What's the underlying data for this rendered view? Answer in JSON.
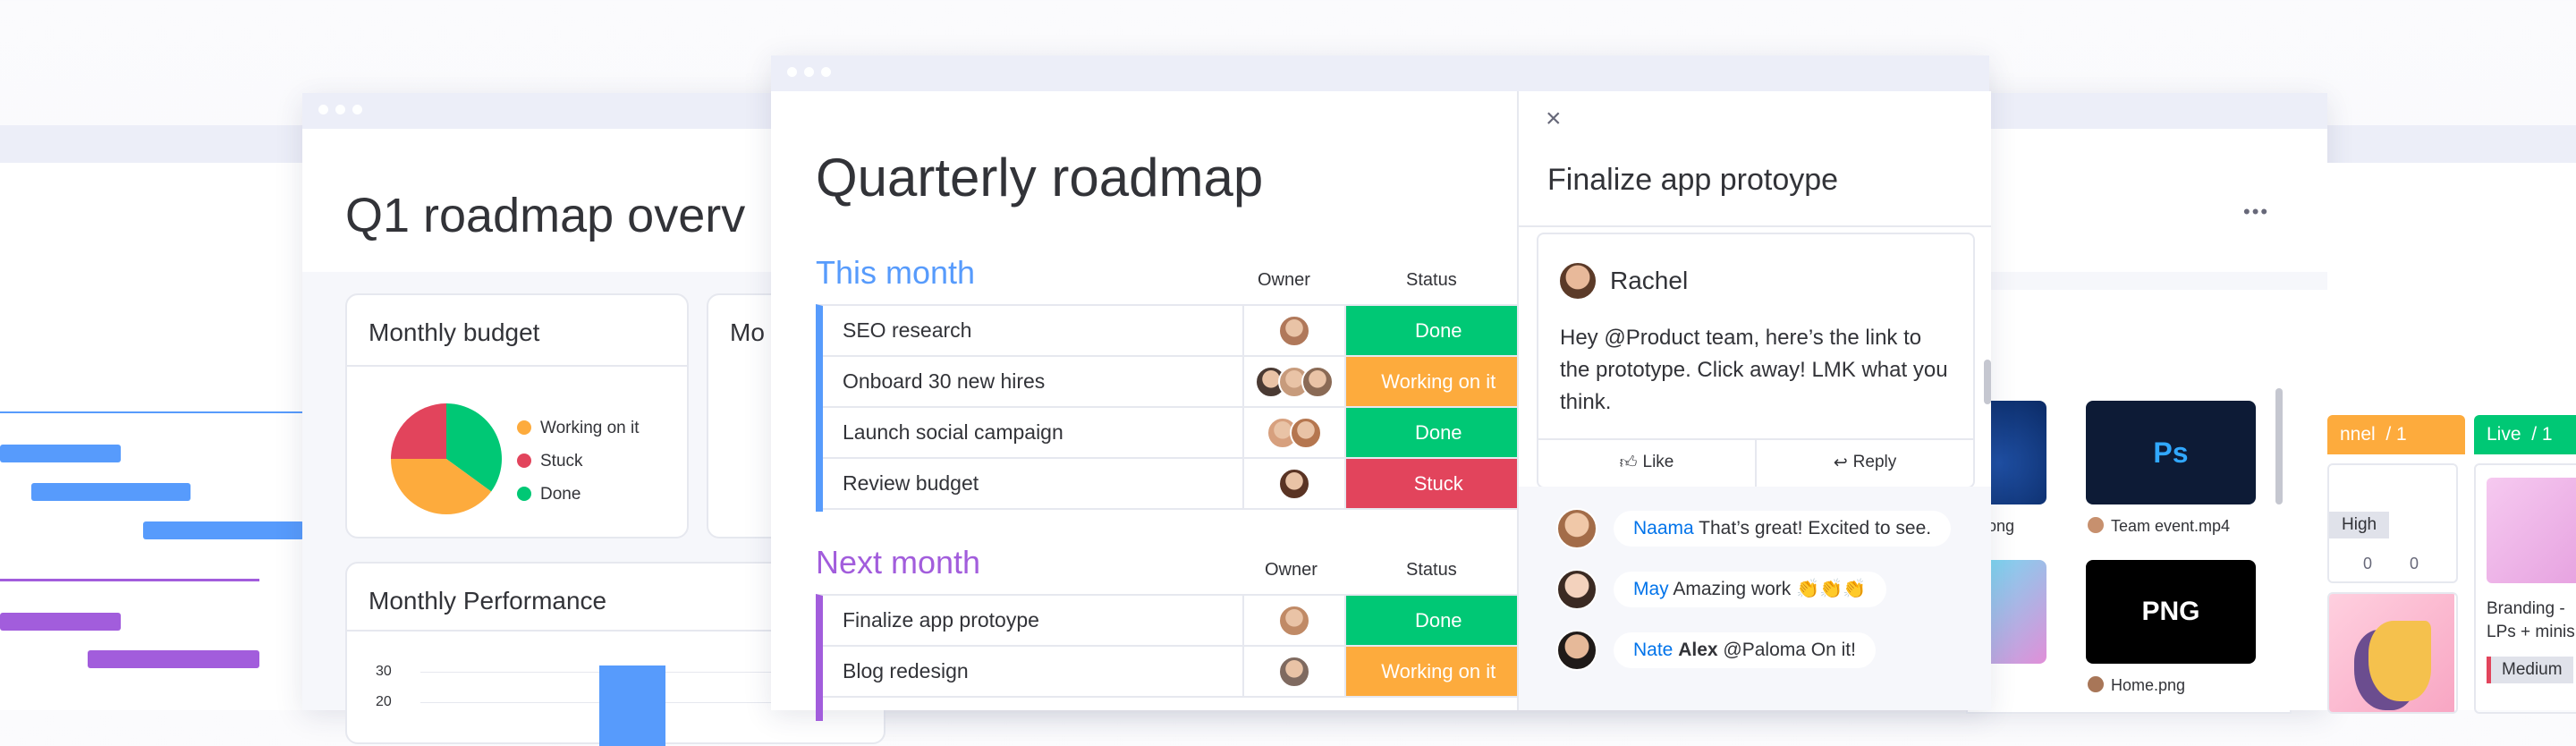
{
  "colors": {
    "blue": "#579bfc",
    "purple": "#a25ddc",
    "done": "#00c875",
    "working": "#fdab3d",
    "stuck": "#e2445c",
    "text": "#323338",
    "link": "#0073ea"
  },
  "back_window": {
    "title": "Q1 roadmap overv",
    "budget_card": {
      "title": "Monthly budget",
      "legend": [
        "Working on it",
        "Stuck",
        "Done"
      ],
      "chart_data": {
        "type": "pie",
        "categories": [
          "Working on it",
          "Stuck",
          "Done"
        ],
        "values": [
          40,
          25,
          35
        ]
      }
    },
    "partial_card_title": "Mo",
    "performance_card": {
      "title": "Monthly Performance",
      "y_ticks": [
        "30",
        "20"
      ]
    }
  },
  "main_window": {
    "title": "Quarterly roadmap",
    "groups": [
      {
        "name": "This month",
        "owner_label": "Owner",
        "status_label": "Status",
        "rows": [
          {
            "name": "SEO research",
            "status": "Done"
          },
          {
            "name": "Onboard 30 new hires",
            "status": "Working on it"
          },
          {
            "name": "Launch social campaign",
            "status": "Done"
          },
          {
            "name": "Review budget",
            "status": "Stuck"
          }
        ]
      },
      {
        "name": "Next month",
        "owner_label": "Owner",
        "status_label": "Status",
        "rows": [
          {
            "name": "Finalize app protoype",
            "status": "Done"
          },
          {
            "name": "Blog redesign",
            "status": "Working on it"
          }
        ]
      }
    ]
  },
  "side_panel": {
    "close_glyph": "×",
    "title": "Finalize app protoype",
    "post": {
      "author": "Rachel",
      "body": "Hey @Product team, here’s the link to the prototype. Click away! LMK what you think.",
      "like_label": "Like",
      "reply_label": "Reply"
    },
    "replies": [
      {
        "name": "Naama",
        "text": "That’s great! Excited to see."
      },
      {
        "name": "May",
        "text": "Amazing work 👏👏👏"
      },
      {
        "name": "Nate",
        "bold": "Alex",
        "text": "@Paloma On it!"
      }
    ]
  },
  "files": {
    "items": [
      {
        "badge": "Ps",
        "caption": "Team event.mp4"
      },
      {
        "badge": "PNG",
        "caption": "Home.png"
      }
    ],
    "partial_caption": "ong"
  },
  "kanban": {
    "col1": {
      "header": "nnel",
      "count": "/ 1",
      "tag": "High",
      "counts": [
        "0",
        "0"
      ]
    },
    "col2": {
      "header": "Live",
      "count": "/ 1",
      "card_text": "Branding - LPs + minis",
      "tag": "Medium"
    }
  },
  "more_glyph": "•••"
}
